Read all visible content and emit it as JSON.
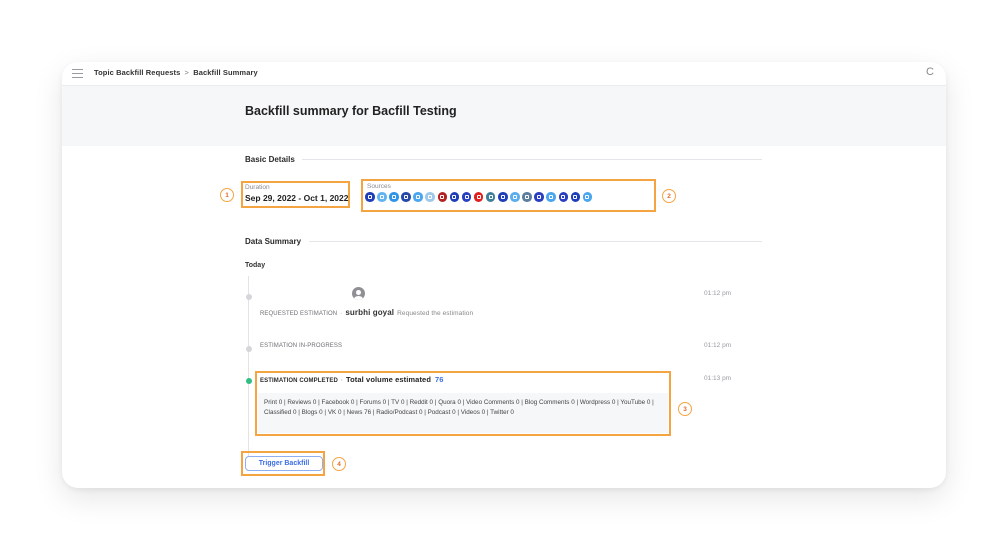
{
  "topbar": {
    "menu_icon": "hamburger-icon",
    "breadcrumb": [
      "Topic Backfill Requests",
      "Backfill Summary"
    ],
    "breadcrumb_separator": ">",
    "refresh_icon": "refresh-icon",
    "refresh_glyph": "C"
  },
  "page": {
    "title": "Backfill summary for Bacfill Testing"
  },
  "basic_details": {
    "section_title": "Basic Details",
    "duration_label": "Duration",
    "duration_value": "Sep 29, 2022 - Oct 1, 2022",
    "sources_label": "Sources",
    "sources": [
      {
        "name": "source-1",
        "color": "#1f3fb8"
      },
      {
        "name": "source-2",
        "color": "#62b4f0"
      },
      {
        "name": "source-3",
        "color": "#2f95e8"
      },
      {
        "name": "facebook",
        "color": "#2748a8"
      },
      {
        "name": "source-5",
        "color": "#4aa6ee"
      },
      {
        "name": "reddit",
        "color": "#9fc9ea"
      },
      {
        "name": "quora",
        "color": "#b22222"
      },
      {
        "name": "source-8",
        "color": "#1f3fb8"
      },
      {
        "name": "source-9",
        "color": "#2a3fc0"
      },
      {
        "name": "youtube",
        "color": "#e02020"
      },
      {
        "name": "source-11",
        "color": "#3f7f9a"
      },
      {
        "name": "source-12",
        "color": "#1f3fb8"
      },
      {
        "name": "source-13",
        "color": "#5aaeee"
      },
      {
        "name": "source-14",
        "color": "#5c7f9e"
      },
      {
        "name": "source-15",
        "color": "#2a3fc0"
      },
      {
        "name": "source-16",
        "color": "#4aa6ee"
      },
      {
        "name": "source-17",
        "color": "#2a3fc0"
      },
      {
        "name": "source-18",
        "color": "#1f3fb8"
      },
      {
        "name": "twitter",
        "color": "#4aa6ee"
      }
    ]
  },
  "data_summary": {
    "section_title": "Data Summary",
    "day_label": "Today",
    "events": [
      {
        "label": "REQUESTED ESTIMATION",
        "user": "surbhi goyal",
        "description": "Requested the estimation",
        "time": "01:12 pm",
        "avatar_icon": "user-avatar-icon"
      },
      {
        "label": "ESTIMATION IN-PROGRESS",
        "time": "01:12 pm"
      },
      {
        "label": "ESTIMATION COMPLETED",
        "total_label": "Total volume estimated",
        "total_value": "76",
        "time": "01:13 pm",
        "breakdown": "Print 0 | Reviews 0 | Facebook 0 | Forums 0 | TV 0 | Reddit 0 | Quora 0 | Video Comments 0 | Blog Comments 0 | Wordpress 0 | YouTube 0 | Classified 0 | Blogs 0 | VK 0 | News 76 | Radio/Podcast 0 | Podcast 0 | Videos 0 | Twitter 0"
      }
    ],
    "separator": "·"
  },
  "actions": {
    "trigger_label": "Trigger Backfill"
  },
  "annotations": [
    "1",
    "2",
    "3",
    "4"
  ],
  "colors": {
    "accent": "#3c6ee6",
    "annotation": "#f5a442",
    "status_complete": "#2fbf83"
  }
}
